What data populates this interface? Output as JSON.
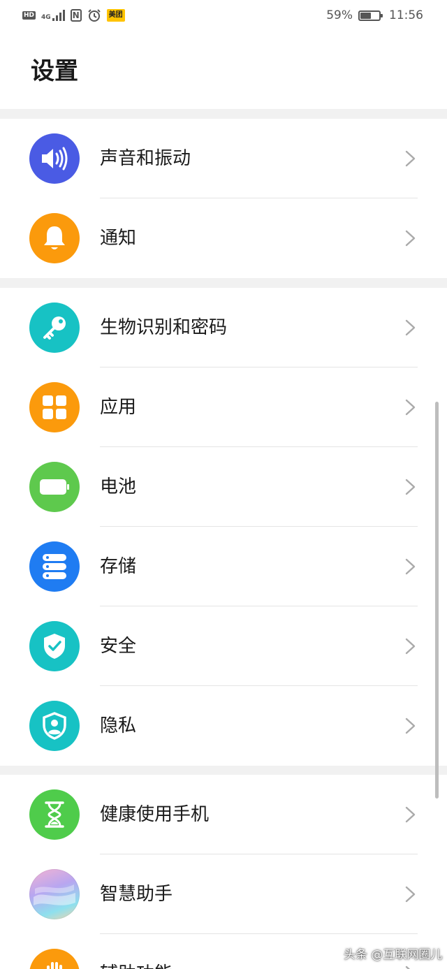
{
  "status_bar": {
    "hd": "HD",
    "signal": "4G",
    "nfc": "N",
    "app_badge": "美团",
    "battery_percent": "59%",
    "battery_level": 0.59,
    "time": "11:56"
  },
  "page_title": "设置",
  "groups": [
    {
      "items": [
        {
          "label": "声音和振动",
          "icon": "volume-icon",
          "color": "#4a5be4"
        },
        {
          "label": "通知",
          "icon": "bell-icon",
          "color": "#fb9a0c"
        }
      ]
    },
    {
      "items": [
        {
          "label": "生物识别和密码",
          "icon": "key-icon",
          "color": "#17c2c4"
        },
        {
          "label": "应用",
          "icon": "apps-grid-icon",
          "color": "#fb9a0c"
        },
        {
          "label": "电池",
          "icon": "battery-icon",
          "color": "#5ec94d"
        },
        {
          "label": "存储",
          "icon": "storage-icon",
          "color": "#1f7cf2"
        },
        {
          "label": "安全",
          "icon": "shield-check-icon",
          "color": "#17c2c4"
        },
        {
          "label": "隐私",
          "icon": "privacy-shield-icon",
          "color": "#17c2c4"
        }
      ]
    },
    {
      "items": [
        {
          "label": "健康使用手机",
          "icon": "hourglass-icon",
          "color": "#4fcc4b"
        },
        {
          "label": "智慧助手",
          "icon": "assistant-icon",
          "color": "#b8a6f0"
        },
        {
          "label": "辅助功能",
          "icon": "hand-icon",
          "color": "#fb9a0c"
        }
      ]
    }
  ],
  "watermark": "头条 @互联网圈儿"
}
